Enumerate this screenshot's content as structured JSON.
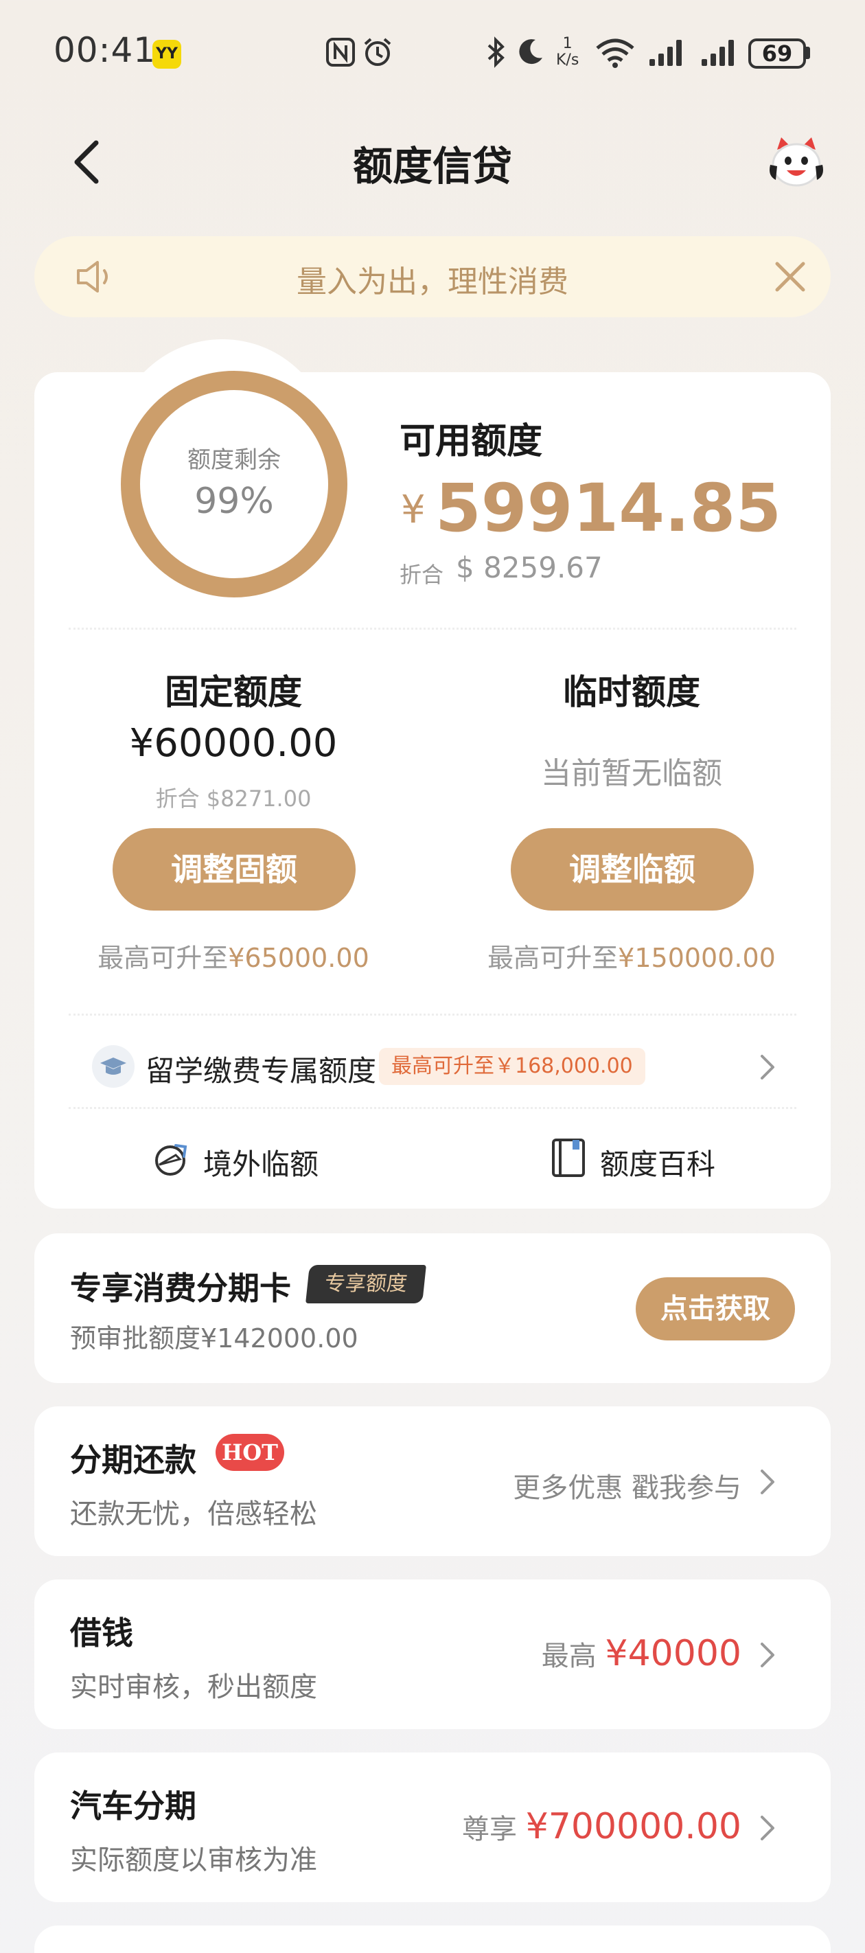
{
  "status_bar": {
    "time": "00:41",
    "yy_badge": "YY",
    "net_speed_value": "1",
    "net_speed_unit": "K/s",
    "battery": "69"
  },
  "header": {
    "title": "额度信贷"
  },
  "notice": {
    "text": "量入为出，理性消费"
  },
  "credit": {
    "ring_label": "额度剩余",
    "ring_percent": "99%",
    "ring_fraction": 0.99,
    "available_label": "可用额度",
    "currency_symbol": "¥",
    "available_amount": "59914.85",
    "converted_label": "折合",
    "converted_amount": "$ 8259.67",
    "fixed": {
      "title": "固定额度",
      "amount": "¥60000.00",
      "converted": "折合 $8271.00",
      "button": "调整固额",
      "note_prefix": "最高可升至",
      "note_amount": "¥65000.00"
    },
    "temporary": {
      "title": "临时额度",
      "status": "当前暂无临额",
      "button": "调整临额",
      "note_prefix": "最高可升至",
      "note_amount": "¥150000.00"
    },
    "study_abroad": {
      "label": "留学缴费专属额度",
      "tag": "最高可升至￥168,000.00"
    },
    "links": {
      "overseas": "境外临额",
      "encyclopedia": "额度百科"
    }
  },
  "exclusive": {
    "title": "专享消费分期卡",
    "tag": "专享额度",
    "subtitle": "预审批额度¥142000.00",
    "button": "点击获取"
  },
  "list": [
    {
      "title": "分期还款",
      "badge": "HOT",
      "subtitle": "还款无忧，倍感轻松",
      "right_text": "更多优惠 戳我参与"
    },
    {
      "title": "借钱",
      "subtitle": "实时审核，秒出额度",
      "right_prefix": "最高",
      "right_amount": "¥40000"
    },
    {
      "title": "汽车分期",
      "subtitle": "实际额度以审核为准",
      "right_prefix": "尊享",
      "right_amount": "¥700000.00"
    }
  ],
  "colors": {
    "accent_gold": "#cc9e6b",
    "amount_gold": "#c4976a",
    "red": "#e14a46",
    "notice_bg": "#fcf5e3"
  }
}
